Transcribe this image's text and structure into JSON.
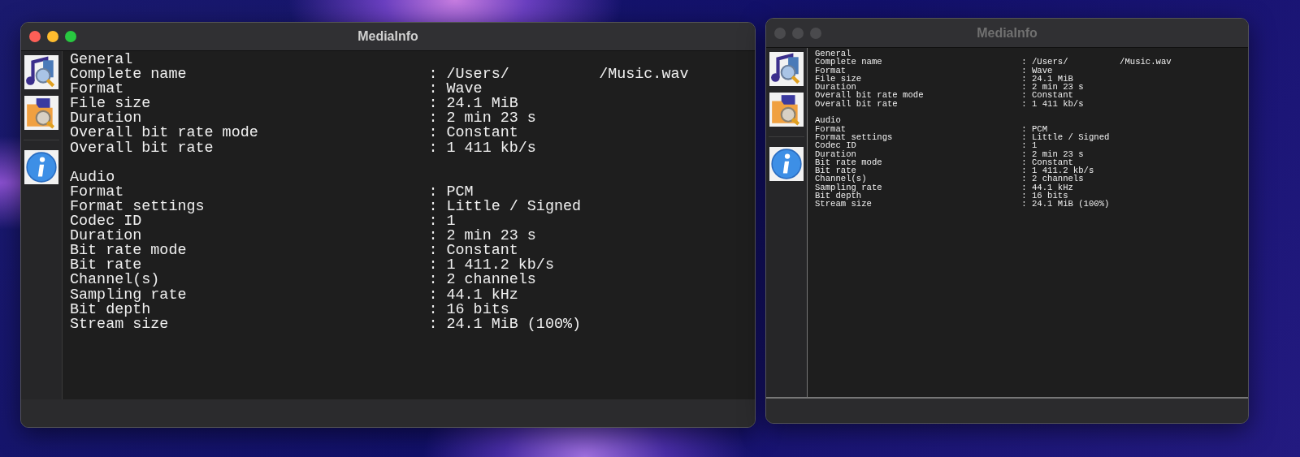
{
  "windows": [
    {
      "title": "MediaInfo",
      "active": true,
      "sections": [
        {
          "title": "General",
          "rows": [
            {
              "label": "Complete name",
              "value_parts": [
                ": /Users/",
                "/Music.wav"
              ]
            },
            {
              "label": "Format",
              "value": ": Wave"
            },
            {
              "label": "File size",
              "value": ": 24.1 MiB"
            },
            {
              "label": "Duration",
              "value": ": 2 min 23 s"
            },
            {
              "label": "Overall bit rate mode",
              "value": ": Constant"
            },
            {
              "label": "Overall bit rate",
              "value": ": 1 411 kb/s"
            }
          ]
        },
        {
          "title": "Audio",
          "rows": [
            {
              "label": "Format",
              "value": ": PCM"
            },
            {
              "label": "Format settings",
              "value": ": Little / Signed"
            },
            {
              "label": "Codec ID",
              "value": ": 1"
            },
            {
              "label": "Duration",
              "value": ": 2 min 23 s"
            },
            {
              "label": "Bit rate mode",
              "value": ": Constant"
            },
            {
              "label": "Bit rate",
              "value": ": 1 411.2 kb/s"
            },
            {
              "label": "Channel(s)",
              "value": ": 2 channels"
            },
            {
              "label": "Sampling rate",
              "value": ": 44.1 kHz"
            },
            {
              "label": "Bit depth",
              "value": ": 16 bits"
            },
            {
              "label": "Stream size",
              "value": ": 24.1 MiB (100%)"
            }
          ]
        }
      ]
    },
    {
      "title": "MediaInfo",
      "active": false,
      "sections": [
        {
          "title": "General",
          "rows": [
            {
              "label": "Complete name",
              "value_parts": [
                ": /Users/",
                "/Music.wav"
              ]
            },
            {
              "label": "Format",
              "value": ": Wave"
            },
            {
              "label": "File size",
              "value": ": 24.1 MiB"
            },
            {
              "label": "Duration",
              "value": ": 2 min 23 s"
            },
            {
              "label": "Overall bit rate mode",
              "value": ": Constant"
            },
            {
              "label": "Overall bit rate",
              "value": ": 1 411 kb/s"
            }
          ]
        },
        {
          "title": "Audio",
          "rows": [
            {
              "label": "Format",
              "value": ": PCM"
            },
            {
              "label": "Format settings",
              "value": ": Little / Signed"
            },
            {
              "label": "Codec ID",
              "value": ": 1"
            },
            {
              "label": "Duration",
              "value": ": 2 min 23 s"
            },
            {
              "label": "Bit rate mode",
              "value": ": Constant"
            },
            {
              "label": "Bit rate",
              "value": ": 1 411.2 kb/s"
            },
            {
              "label": "Channel(s)",
              "value": ": 2 channels"
            },
            {
              "label": "Sampling rate",
              "value": ": 44.1 kHz"
            },
            {
              "label": "Bit depth",
              "value": ": 16 bits"
            },
            {
              "label": "Stream size",
              "value": ": 24.1 MiB (100%)"
            }
          ]
        }
      ]
    }
  ]
}
